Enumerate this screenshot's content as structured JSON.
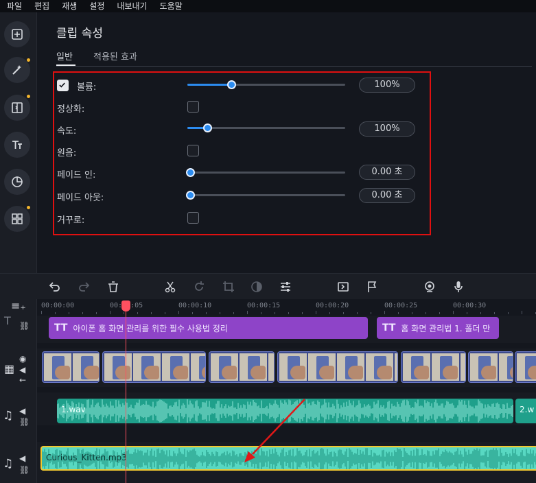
{
  "menu": [
    "파일",
    "편집",
    "재생",
    "설정",
    "내보내기",
    "도움말"
  ],
  "panel": {
    "title": "클립 속성",
    "tabs": [
      "일반",
      "적용된 효과"
    ]
  },
  "props": {
    "volume_label": "볼륨:",
    "volume_checked": true,
    "volume_level": 0.26,
    "volume_value": "100%",
    "normalize_label": "정상화:",
    "speed_label": "속도:",
    "speed_level": 0.11,
    "speed_value": "100%",
    "original_label": "원음:",
    "fadein_label": "페이드 인:",
    "fadein_level": 0.0,
    "fadein_value": "0.00 초",
    "fadeout_label": "페이드 아웃:",
    "fadeout_level": 0.0,
    "fadeout_value": "0.00 초",
    "reverse_label": "거꾸로:"
  },
  "ruler": [
    "00:00:00",
    "00:00:05",
    "00:00:10",
    "00:00:15",
    "00:00:20",
    "00:00:25",
    "00:00:30"
  ],
  "timeline": {
    "title_clip_1": "아이폰 홈 화면 관리를 위한 필수 사용법 정리",
    "title_clip_2": "홈 화면 관리법 1. 폴더 만",
    "audio_clip_1": "1.wav",
    "audio_clip_2": "2.w",
    "music_clip": "Curious_Kitten.mp3"
  },
  "colors": {
    "accent": "#2c8cf0",
    "title_clip": "#8e44c8",
    "audio_clip": "#1fa08b",
    "highlight": "#e01010",
    "playhead": "#ff5060"
  }
}
